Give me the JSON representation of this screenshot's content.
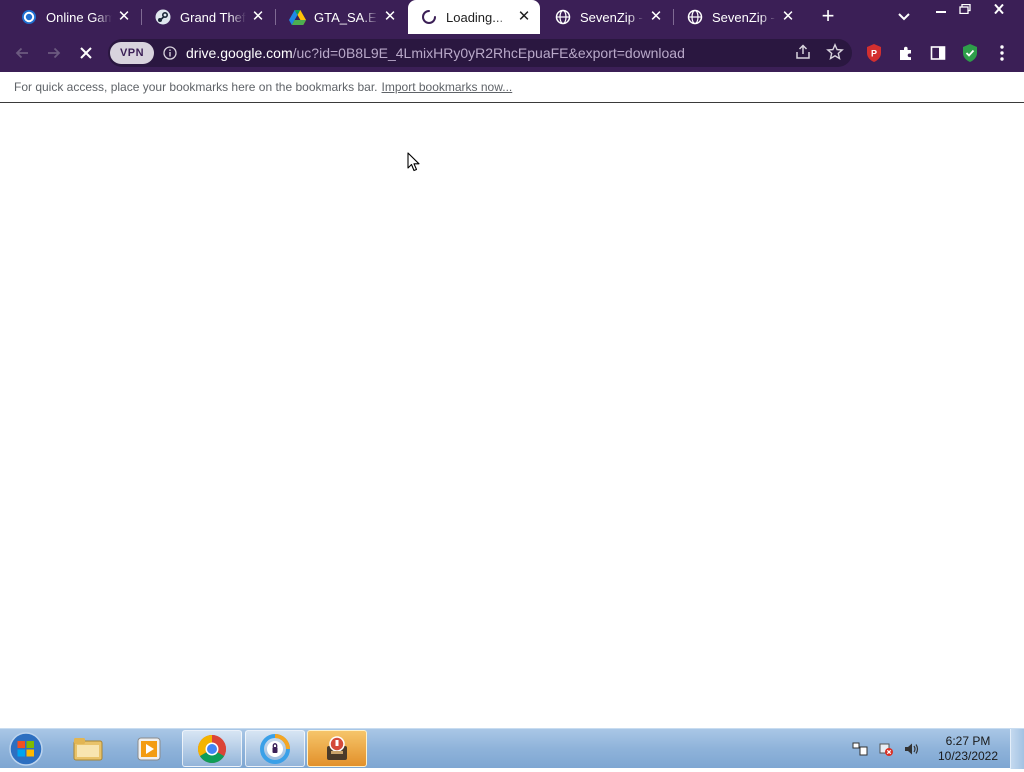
{
  "browser": {
    "tabs": [
      {
        "title": "Online Game",
        "icon": "online-games-icon",
        "active": false
      },
      {
        "title": "Grand Theft",
        "icon": "steam-icon",
        "active": false
      },
      {
        "title": "GTA_SA.EXE",
        "icon": "google-drive-icon",
        "active": false
      },
      {
        "title": "Loading...",
        "icon": "loading-spinner-icon",
        "active": true
      },
      {
        "title": "SevenZip - U",
        "icon": "globe-icon",
        "active": false
      },
      {
        "title": "SevenZip - U",
        "icon": "globe-icon",
        "active": false
      }
    ],
    "close_glyph": "✕",
    "newtab_glyph": "+",
    "url_host": "drive.google.com",
    "url_path": "/uc?id=0B8L9E_4LmixHRy0yR2RhcEpuaFE&export=download",
    "vpn_label": "VPN",
    "extension_badge": "P"
  },
  "bookmarks_bar": {
    "message": "For quick access, place your bookmarks here on the bookmarks bar.",
    "import_link": "Import bookmarks now..."
  },
  "taskbar": {
    "apps": [
      {
        "name": "file-explorer",
        "state": "pinned"
      },
      {
        "name": "media-player",
        "state": "pinned"
      },
      {
        "name": "chrome",
        "state": "pinned-active"
      },
      {
        "name": "vpn-app",
        "state": "pinned-active"
      },
      {
        "name": "installer",
        "state": "running"
      }
    ],
    "clock_time": "6:27 PM",
    "clock_date": "10/23/2022"
  },
  "colors": {
    "chrome_frame": "#3b1f56",
    "omnibox": "#2a1740",
    "taskbar": "#8fb3da"
  }
}
